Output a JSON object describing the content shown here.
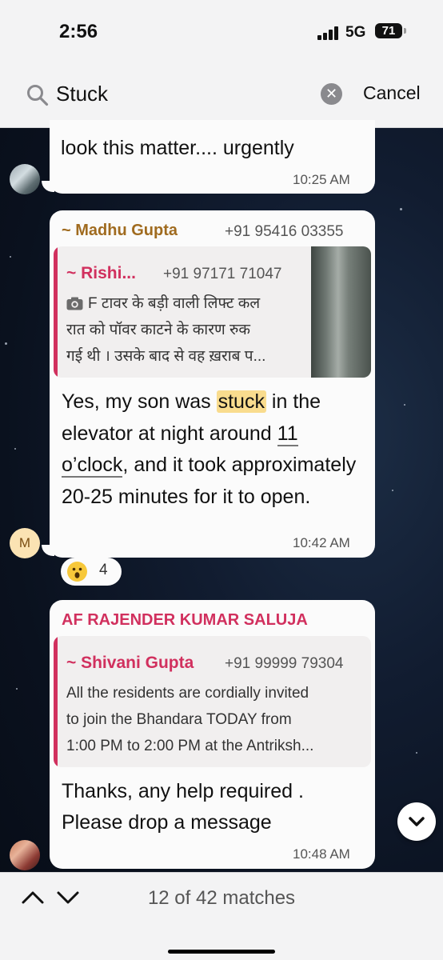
{
  "status_bar": {
    "time": "2:56",
    "network": "5G",
    "battery": "71"
  },
  "search": {
    "query": "Stuck",
    "cancel_label": "Cancel",
    "icon": "search-icon"
  },
  "messages": [
    {
      "partial_text": "look this matter.... urgently",
      "time": "10:25 AM"
    },
    {
      "sender": "~ Madhu Gupta",
      "sender_color": "#a06b1f",
      "phone": "+91 95416 03355",
      "quote": {
        "sender": "~ Rishi...",
        "phone": "+91 97171 71047",
        "icon": "camera-icon",
        "lines": [
          "F टावर के बड़ी वाली लिफ्ट कल",
          "रात को पॉवर काटने के कारण रुक",
          "गई थी । उसके बाद से वह ख़राब प..."
        ]
      },
      "text_before": "Yes, my son was ",
      "highlight": "stuck",
      "text_mid": " in the elevator at night around ",
      "underlined": "11 o’clock",
      "text_after": ", and it took approximately 20-25 minutes for it to open.",
      "time": "10:42 AM",
      "avatar_initial": "M",
      "reaction": {
        "emoji": "surprised-face",
        "count": "4"
      }
    },
    {
      "sender": "AF RAJENDER KUMAR SALUJA",
      "sender_color": "#d1305e",
      "quote": {
        "sender": "~ Shivani Gupta",
        "phone": "+91 99999 79304",
        "lines": [
          "All the residents are cordially invited",
          "to join the Bhandara TODAY from",
          "1:00 PM to 2:00 PM at the Antriksh..."
        ]
      },
      "lines": [
        "Thanks,  any help required .",
        "Please drop a message"
      ],
      "time": "10:48 AM"
    }
  ],
  "bottom_bar": {
    "match_text": "12 of 42 matches"
  },
  "colors": {
    "quote_accent": "#d1305e",
    "highlight": "#f9dc8e",
    "chat_background": "#0c1424"
  }
}
